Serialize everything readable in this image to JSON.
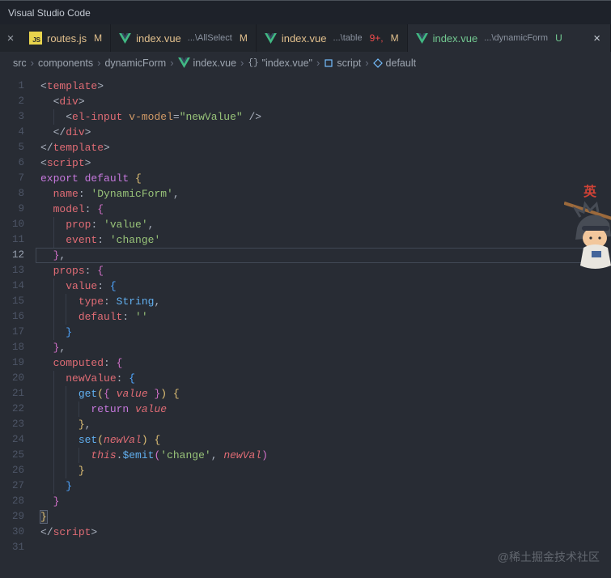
{
  "window": {
    "title": "Visual Studio Code"
  },
  "tabbar": {
    "leading_close": "×",
    "tabs": [
      {
        "icon": "js",
        "label": "routes.js",
        "desc": "",
        "label_status": "modified",
        "badges": [
          {
            "text": "M",
            "color": "modified"
          }
        ],
        "active": false
      },
      {
        "icon": "vue",
        "label": "index.vue",
        "desc": "...\\AllSelect",
        "label_status": "modified",
        "badges": [
          {
            "text": "M",
            "color": "modified"
          }
        ],
        "active": false
      },
      {
        "icon": "vue",
        "label": "index.vue",
        "desc": "...\\table",
        "label_status": "modified",
        "badges": [
          {
            "text": "9+,",
            "color": "error"
          },
          {
            "text": "M",
            "color": "modified"
          }
        ],
        "active": false
      },
      {
        "icon": "vue",
        "label": "index.vue",
        "desc": "...\\dynamicForm",
        "label_status": "untracked",
        "badges": [
          {
            "text": "U",
            "color": "untracked"
          }
        ],
        "active": true,
        "close": "×"
      }
    ]
  },
  "breadcrumbs": {
    "separator": "›",
    "items": [
      {
        "label": "src"
      },
      {
        "label": "components"
      },
      {
        "label": "dynamicForm"
      },
      {
        "label": "index.vue",
        "icon": "vue"
      },
      {
        "label": "\"index.vue\"",
        "icon": "braces"
      },
      {
        "label": "script",
        "icon": "module"
      },
      {
        "label": "default",
        "icon": "symbol"
      }
    ]
  },
  "colors": {
    "status": {
      "modified": "#e2c08d",
      "untracked": "#73c991",
      "error": "#f14c4c"
    },
    "vue_green": "#41b883",
    "js_yellow": "#e8d44d",
    "editor_bg": "#282c34",
    "tabbar_bg": "#21252b"
  },
  "editor": {
    "token_colors": {
      "p": "#abb2bf",
      "tag": "#e06c75",
      "attr": "#d19a66",
      "str": "#98c379",
      "kw": "#c678dd",
      "key": "#e06c75",
      "fn": "#61afef",
      "builtin": "#61afef",
      "param": "#e06c75",
      "this": "#e06c75",
      "b1": "#e0c075",
      "b2": "#d170c8",
      "b3": "#4fa6ff"
    },
    "lines": [
      {
        "n": 1,
        "tokens": [
          [
            "p",
            "<"
          ],
          [
            "tag",
            "template"
          ],
          [
            "p",
            ">"
          ]
        ]
      },
      {
        "n": 2,
        "tokens": [
          [
            "",
            "  "
          ],
          [
            "p",
            "<"
          ],
          [
            "tag",
            "div"
          ],
          [
            "p",
            ">"
          ]
        ]
      },
      {
        "n": 3,
        "tokens": [
          [
            "",
            "    "
          ],
          [
            "p",
            "<"
          ],
          [
            "tag",
            "el-input"
          ],
          [
            "p",
            " "
          ],
          [
            "attr",
            "v-model"
          ],
          [
            "p",
            "="
          ],
          [
            "str",
            "\"newValue\""
          ],
          [
            "p",
            " />"
          ]
        ]
      },
      {
        "n": 4,
        "tokens": [
          [
            "",
            "  "
          ],
          [
            "p",
            "</"
          ],
          [
            "tag",
            "div"
          ],
          [
            "p",
            ">"
          ]
        ]
      },
      {
        "n": 5,
        "tokens": [
          [
            "p",
            "</"
          ],
          [
            "tag",
            "template"
          ],
          [
            "p",
            ">"
          ]
        ]
      },
      {
        "n": 6,
        "tokens": [
          [
            "p",
            "<"
          ],
          [
            "tag",
            "script"
          ],
          [
            "p",
            ">"
          ]
        ]
      },
      {
        "n": 7,
        "tokens": [
          [
            "kw",
            "export"
          ],
          [
            "p",
            " "
          ],
          [
            "kw",
            "default"
          ],
          [
            "p",
            " "
          ],
          [
            "b1",
            "{"
          ]
        ]
      },
      {
        "n": 8,
        "tokens": [
          [
            "",
            "  "
          ],
          [
            "key",
            "name"
          ],
          [
            "p",
            ": "
          ],
          [
            "str",
            "'DynamicForm'"
          ],
          [
            "p",
            ","
          ]
        ]
      },
      {
        "n": 9,
        "tokens": [
          [
            "",
            "  "
          ],
          [
            "key",
            "model"
          ],
          [
            "p",
            ": "
          ],
          [
            "b2",
            "{"
          ]
        ]
      },
      {
        "n": 10,
        "tokens": [
          [
            "",
            "    "
          ],
          [
            "key",
            "prop"
          ],
          [
            "p",
            ": "
          ],
          [
            "str",
            "'value'"
          ],
          [
            "p",
            ","
          ]
        ]
      },
      {
        "n": 11,
        "tokens": [
          [
            "",
            "    "
          ],
          [
            "key",
            "event"
          ],
          [
            "p",
            ": "
          ],
          [
            "str",
            "'change'"
          ]
        ]
      },
      {
        "n": 12,
        "current": true,
        "tokens": [
          [
            "",
            "  "
          ],
          [
            "b2",
            "}"
          ],
          [
            "p",
            ","
          ]
        ]
      },
      {
        "n": 13,
        "tokens": [
          [
            "",
            "  "
          ],
          [
            "key",
            "props"
          ],
          [
            "p",
            ": "
          ],
          [
            "b2",
            "{"
          ]
        ]
      },
      {
        "n": 14,
        "tokens": [
          [
            "",
            "    "
          ],
          [
            "key",
            "value"
          ],
          [
            "p",
            ": "
          ],
          [
            "b3",
            "{"
          ]
        ]
      },
      {
        "n": 15,
        "tokens": [
          [
            "",
            "      "
          ],
          [
            "key",
            "type"
          ],
          [
            "p",
            ": "
          ],
          [
            "builtin",
            "String"
          ],
          [
            "p",
            ","
          ]
        ]
      },
      {
        "n": 16,
        "tokens": [
          [
            "",
            "      "
          ],
          [
            "key",
            "default"
          ],
          [
            "p",
            ": "
          ],
          [
            "str",
            "''"
          ]
        ]
      },
      {
        "n": 17,
        "tokens": [
          [
            "",
            "    "
          ],
          [
            "b3",
            "}"
          ]
        ]
      },
      {
        "n": 18,
        "tokens": [
          [
            "",
            "  "
          ],
          [
            "b2",
            "}"
          ],
          [
            "p",
            ","
          ]
        ]
      },
      {
        "n": 19,
        "tokens": [
          [
            "",
            "  "
          ],
          [
            "key",
            "computed"
          ],
          [
            "p",
            ": "
          ],
          [
            "b2",
            "{"
          ]
        ]
      },
      {
        "n": 20,
        "tokens": [
          [
            "",
            "    "
          ],
          [
            "key",
            "newValue"
          ],
          [
            "p",
            ": "
          ],
          [
            "b3",
            "{"
          ]
        ]
      },
      {
        "n": 21,
        "tokens": [
          [
            "",
            "      "
          ],
          [
            "fn",
            "get"
          ],
          [
            "b1",
            "("
          ],
          [
            "b2",
            "{"
          ],
          [
            "param",
            " value "
          ],
          [
            "b2",
            "}"
          ],
          [
            "b1",
            ")"
          ],
          [
            "p",
            " "
          ],
          [
            "b1",
            "{"
          ]
        ]
      },
      {
        "n": 22,
        "tokens": [
          [
            "",
            "        "
          ],
          [
            "kw",
            "return"
          ],
          [
            "p",
            " "
          ],
          [
            "param",
            "value"
          ]
        ]
      },
      {
        "n": 23,
        "tokens": [
          [
            "",
            "      "
          ],
          [
            "b1",
            "}"
          ],
          [
            "p",
            ","
          ]
        ]
      },
      {
        "n": 24,
        "tokens": [
          [
            "",
            "      "
          ],
          [
            "fn",
            "set"
          ],
          [
            "b1",
            "("
          ],
          [
            "param",
            "newVal"
          ],
          [
            "b1",
            ")"
          ],
          [
            "p",
            " "
          ],
          [
            "b1",
            "{"
          ]
        ]
      },
      {
        "n": 25,
        "tokens": [
          [
            "",
            "        "
          ],
          [
            "this",
            "this"
          ],
          [
            "p",
            "."
          ],
          [
            "fn",
            "$emit"
          ],
          [
            "b2",
            "("
          ],
          [
            "str",
            "'change'"
          ],
          [
            "p",
            ", "
          ],
          [
            "param",
            "newVal"
          ],
          [
            "b2",
            ")"
          ]
        ]
      },
      {
        "n": 26,
        "tokens": [
          [
            "",
            "      "
          ],
          [
            "b1",
            "}"
          ]
        ]
      },
      {
        "n": 27,
        "tokens": [
          [
            "",
            "    "
          ],
          [
            "b3",
            "}"
          ]
        ]
      },
      {
        "n": 28,
        "tokens": [
          [
            "",
            "  "
          ],
          [
            "b2",
            "}"
          ]
        ]
      },
      {
        "n": 29,
        "tokens": [
          [
            "b1 bm",
            "}"
          ]
        ]
      },
      {
        "n": 30,
        "tokens": [
          [
            "p",
            "</"
          ],
          [
            "tag",
            "script"
          ],
          [
            "p",
            ">"
          ]
        ]
      },
      {
        "n": 31,
        "tokens": []
      }
    ]
  },
  "watermark": "@稀土掘金技术社区",
  "mascot_label": "英"
}
